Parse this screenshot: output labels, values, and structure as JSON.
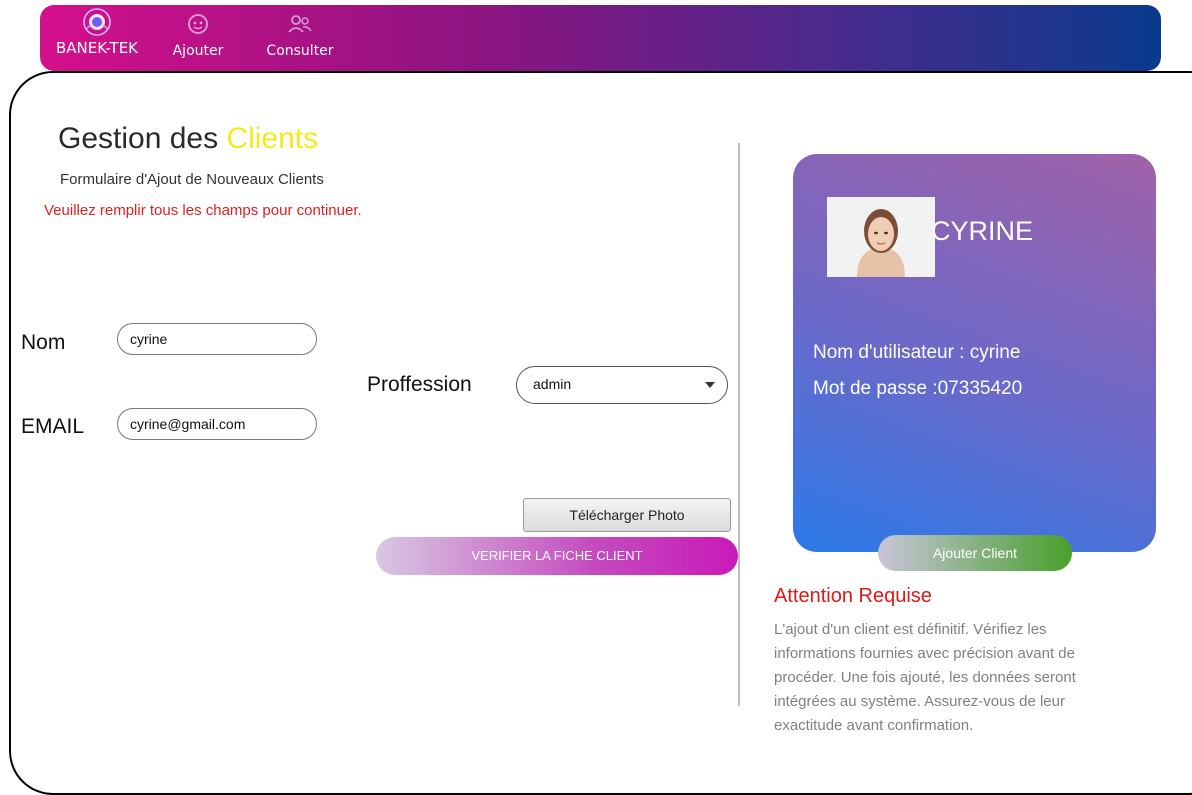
{
  "nav": {
    "brand_label": "BANEK-TEK",
    "add_label": "Ajouter",
    "view_label": "Consulter"
  },
  "header": {
    "title_main": "Gestion des ",
    "title_accent": "Clients",
    "subtitle": "Formulaire d'Ajout de Nouveaux Clients",
    "warning": "Veuillez remplir tous les champs  pour continuer."
  },
  "form": {
    "nom_label": "Nom",
    "nom_value": "cyrine",
    "email_label": "EMAIL",
    "email_value": "cyrine@gmail.com",
    "profession_label": "Proffession",
    "profession_value": "admin",
    "upload_label": "Télécharger Photo",
    "verify_label": "VERIFIER LA FICHE CLIENT"
  },
  "profile": {
    "name": "CYRINE",
    "username_line": "Nom d'utilisateur : cyrine",
    "password_line": "Mot de passe :07335420",
    "add_button": "Ajouter Client"
  },
  "attention": {
    "title": "Attention Requise",
    "body": "L'ajout d'un client est définitif. Vérifiez les informations fournies avec précision avant de procéder. Une fois ajouté, les données seront intégrées au système. Assurez-vous de leur exactitude avant confirmation."
  },
  "colors": {
    "accent_yellow": "#f6ea1a",
    "warning_red": "#e02020",
    "nav_start": "#d4108b",
    "nav_end": "#0a3a8c"
  }
}
